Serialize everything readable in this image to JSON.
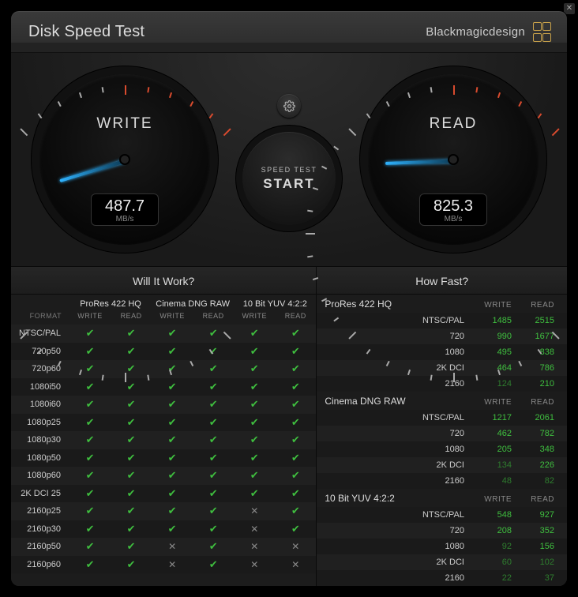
{
  "title": "Disk Speed Test",
  "brand": "Blackmagicdesign",
  "gauges": {
    "write": {
      "label": "WRITE",
      "value": "487.7",
      "unit": "MB/s",
      "angle": 163
    },
    "read": {
      "label": "READ",
      "value": "825.3",
      "unit": "MB/s",
      "angle": 178
    }
  },
  "settings_icon": "gear-icon",
  "start": {
    "line1": "SPEED TEST",
    "line2": "START"
  },
  "will_it_work": {
    "title": "Will It Work?",
    "format_header": "FORMAT",
    "groups": [
      "ProRes 422 HQ",
      "Cinema DNG RAW",
      "10 Bit YUV 4:2:2"
    ],
    "sub": [
      "WRITE",
      "READ",
      "WRITE",
      "READ",
      "WRITE",
      "READ"
    ],
    "rows": [
      {
        "fmt": "NTSC/PAL",
        "cells": [
          1,
          1,
          1,
          1,
          1,
          1
        ]
      },
      {
        "fmt": "720p50",
        "cells": [
          1,
          1,
          1,
          1,
          1,
          1
        ]
      },
      {
        "fmt": "720p60",
        "cells": [
          1,
          1,
          1,
          1,
          1,
          1
        ]
      },
      {
        "fmt": "1080i50",
        "cells": [
          1,
          1,
          1,
          1,
          1,
          1
        ]
      },
      {
        "fmt": "1080i60",
        "cells": [
          1,
          1,
          1,
          1,
          1,
          1
        ]
      },
      {
        "fmt": "1080p25",
        "cells": [
          1,
          1,
          1,
          1,
          1,
          1
        ]
      },
      {
        "fmt": "1080p30",
        "cells": [
          1,
          1,
          1,
          1,
          1,
          1
        ]
      },
      {
        "fmt": "1080p50",
        "cells": [
          1,
          1,
          1,
          1,
          1,
          1
        ]
      },
      {
        "fmt": "1080p60",
        "cells": [
          1,
          1,
          1,
          1,
          1,
          1
        ]
      },
      {
        "fmt": "2K DCI 25",
        "cells": [
          1,
          1,
          1,
          1,
          1,
          1
        ]
      },
      {
        "fmt": "2160p25",
        "cells": [
          1,
          1,
          1,
          1,
          0,
          1
        ]
      },
      {
        "fmt": "2160p30",
        "cells": [
          1,
          1,
          1,
          1,
          0,
          1
        ]
      },
      {
        "fmt": "2160p50",
        "cells": [
          1,
          1,
          0,
          1,
          0,
          0
        ]
      },
      {
        "fmt": "2160p60",
        "cells": [
          1,
          1,
          0,
          1,
          0,
          0
        ]
      }
    ]
  },
  "how_fast": {
    "title": "How Fast?",
    "col_write": "WRITE",
    "col_read": "READ",
    "groups": [
      {
        "name": "ProRes 422 HQ",
        "rows": [
          {
            "fmt": "NTSC/PAL",
            "w": "1485",
            "r": "2515"
          },
          {
            "fmt": "720",
            "w": "990",
            "r": "1677"
          },
          {
            "fmt": "1080",
            "w": "495",
            "r": "838"
          },
          {
            "fmt": "2K DCI",
            "w": "464",
            "r": "786"
          },
          {
            "fmt": "2160",
            "w": "124",
            "r": "210"
          }
        ]
      },
      {
        "name": "Cinema DNG RAW",
        "rows": [
          {
            "fmt": "NTSC/PAL",
            "w": "1217",
            "r": "2061"
          },
          {
            "fmt": "720",
            "w": "462",
            "r": "782"
          },
          {
            "fmt": "1080",
            "w": "205",
            "r": "348"
          },
          {
            "fmt": "2K DCI",
            "w": "134",
            "r": "226"
          },
          {
            "fmt": "2160",
            "w": "48",
            "r": "82"
          }
        ]
      },
      {
        "name": "10 Bit YUV 4:2:2",
        "rows": [
          {
            "fmt": "NTSC/PAL",
            "w": "548",
            "r": "927"
          },
          {
            "fmt": "720",
            "w": "208",
            "r": "352"
          },
          {
            "fmt": "1080",
            "w": "92",
            "r": "156"
          },
          {
            "fmt": "2K DCI",
            "w": "60",
            "r": "102"
          },
          {
            "fmt": "2160",
            "w": "22",
            "r": "37"
          }
        ]
      }
    ]
  }
}
